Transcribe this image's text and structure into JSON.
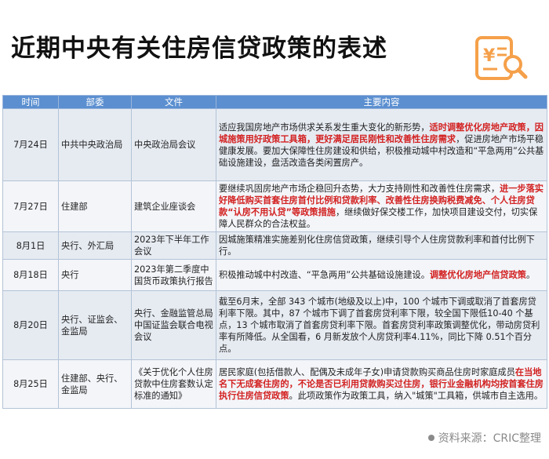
{
  "title": "近期中央有关住房信贷政策的表述",
  "logo": {
    "icon": "yuan-document-search-icon",
    "color": "#f5a04a"
  },
  "table": {
    "headers": [
      "时间",
      "部委",
      "文件",
      "主要内容"
    ],
    "rows": [
      {
        "date": "7月24日",
        "org": "中共中央政治局",
        "doc": "中央政治局会议",
        "content": [
          {
            "t": "适应我国房地产市场供求关系发生重大变化的新形势，",
            "r": false
          },
          {
            "t": "适时调整优化房地产政策，因城施策用好政策工具箱，更好满足居民刚性和改善性住房需求",
            "r": true
          },
          {
            "t": "，促进房地产市场平稳健康发展。要加大保障性住房建设和供给，积极推动城中村改造和“平急两用”公共基础设施建设，盘活改造各类闲置房产。",
            "r": false
          }
        ]
      },
      {
        "date": "7月27日",
        "org": "住建部",
        "doc": "建筑企业座谈会",
        "content": [
          {
            "t": "要继续巩固房地产市场企稳回升态势，大力支持刚性和改善性住房需求，",
            "r": false
          },
          {
            "t": "进一步落实好降低购买首套住房首付比例和贷款利率、改善性住房换购税费减免、个人住房贷款“认房不用认贷”等政策措施",
            "r": true
          },
          {
            "t": "，继续做好保交楼工作，加快项目建设交付，切实保障人民群众的合法权益。",
            "r": false
          }
        ]
      },
      {
        "date": "8月1日",
        "org": "央行、外汇局",
        "doc": "2023年下半年工作会议",
        "content": [
          {
            "t": "因城施策精准实施差别化住房信贷政策，继续引导个人住房贷款利率和首付比例下行。",
            "r": false
          }
        ]
      },
      {
        "date": "8月18日",
        "org": "央行",
        "doc": "2023年第二季度中国货币政策执行报告",
        "content": [
          {
            "t": "积极推动城中村改造、“平急两用”公共基础设施建设。",
            "r": false
          },
          {
            "t": "调整优化房地产信贷政策",
            "r": true
          },
          {
            "t": "。",
            "r": false
          }
        ]
      },
      {
        "date": "8月20日",
        "org": "央行、证监会、金监局",
        "doc": "央行、金融监管总局中国证监会联合电视会议",
        "content": [
          {
            "t": "截至6月末，全部 343 个城市(地级及以上)中，100 个城市下调或取消了首套房贷利率下限。其中，87 个城市下调了首套房贷利率下限，较全国下限低10-40 个基点，13 个城市取消了首套房贷利率下限。首套房贷利率政策调整优化，带动房贷利率有所降低。从全国看，6 月新发放个人房贷利率4.11%，同比下降 0.51个百分点。",
            "r": false
          }
        ]
      },
      {
        "date": "8月25日",
        "org": "住建部、央行、金监局",
        "doc": "《关于优化个人住房贷款中住房套数认定标准的通知》",
        "content": [
          {
            "t": "居民家庭(包括借款人、配偶及未成年子女)申请贷款购买商品住房时家庭成员",
            "r": false
          },
          {
            "t": "在当地名下无成套住房的，不论是否已利用贷款购买过住房，银行业金融机构均按首套住房执行住房信贷政策",
            "r": true
          },
          {
            "t": "。此项政策作为政策工具，纳入\"城策\"工具箱，供城市自主选用。",
            "r": false
          }
        ]
      }
    ]
  },
  "source": "资料来源：CRIC整理",
  "watermark": "CRIC"
}
